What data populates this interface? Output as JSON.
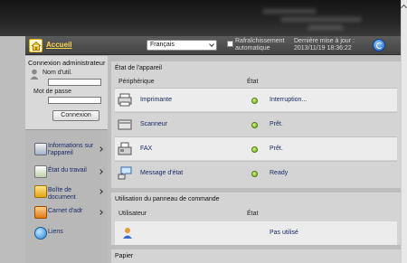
{
  "header": {
    "home_label": "Accueil",
    "language": "Français",
    "auto_refresh": "Rafraîchissement automatique",
    "last_update_label": "Dernière mise à jour :",
    "last_update_value": "2013/11/19 18:36:22"
  },
  "login": {
    "title": "Connexion administrateur",
    "user_label": "Nom d'util.",
    "password_label": "Mot de passe",
    "button": "Connexion"
  },
  "nav": [
    {
      "label": "Informations sur l'appareil",
      "icon": "device-info-icon"
    },
    {
      "label": "État du travail",
      "icon": "job-status-icon"
    },
    {
      "label": "Boîte de document",
      "icon": "document-box-icon"
    },
    {
      "label": "Carnet d'adr",
      "icon": "address-book-icon"
    },
    {
      "label": "Liens",
      "icon": "links-icon"
    }
  ],
  "device_status": {
    "title": "État de l'appareil",
    "col_device": "Périphérique",
    "col_state": "État",
    "rows": [
      {
        "name": "Imprimante",
        "status": "Interruption..."
      },
      {
        "name": "Scanneur",
        "status": "Prêt."
      },
      {
        "name": "FAX",
        "status": "Prêt."
      },
      {
        "name": "Message d'état",
        "status": "Ready"
      }
    ]
  },
  "panel_usage": {
    "title": "Utilisation du panneau de commande",
    "col_user": "Utilisateur",
    "col_state": "État",
    "status": "Pas utilisé"
  },
  "paper": {
    "title": "Papier"
  },
  "colors": {
    "header_bg": "#4a4a4a",
    "accent_yellow": "#ffd84a",
    "status_green": "#7fbf22",
    "link_blue": "#1a2a66"
  }
}
